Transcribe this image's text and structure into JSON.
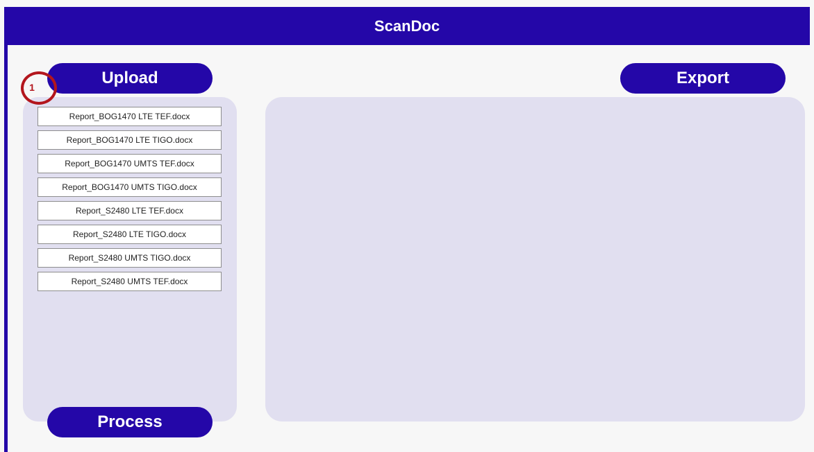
{
  "header": {
    "title": "ScanDoc"
  },
  "buttons": {
    "upload_label": "Upload",
    "export_label": "Export",
    "process_label": "Process"
  },
  "files": [
    "Report_BOG1470 LTE TEF.docx",
    "Report_BOG1470 LTE TIGO.docx",
    "Report_BOG1470 UMTS TEF.docx",
    "Report_BOG1470 UMTS TIGO.docx",
    "Report_S2480 LTE TEF.docx",
    "Report_S2480 LTE TIGO.docx",
    "Report_S2480 UMTS TIGO.docx",
    "Report_S2480 UMTS TEF.docx"
  ],
  "annotation": {
    "marker_number": "1"
  },
  "colors": {
    "brand": "#2407a8",
    "panel": "#e1dff0",
    "background": "#f7f7f7",
    "marker": "#b3161d"
  }
}
